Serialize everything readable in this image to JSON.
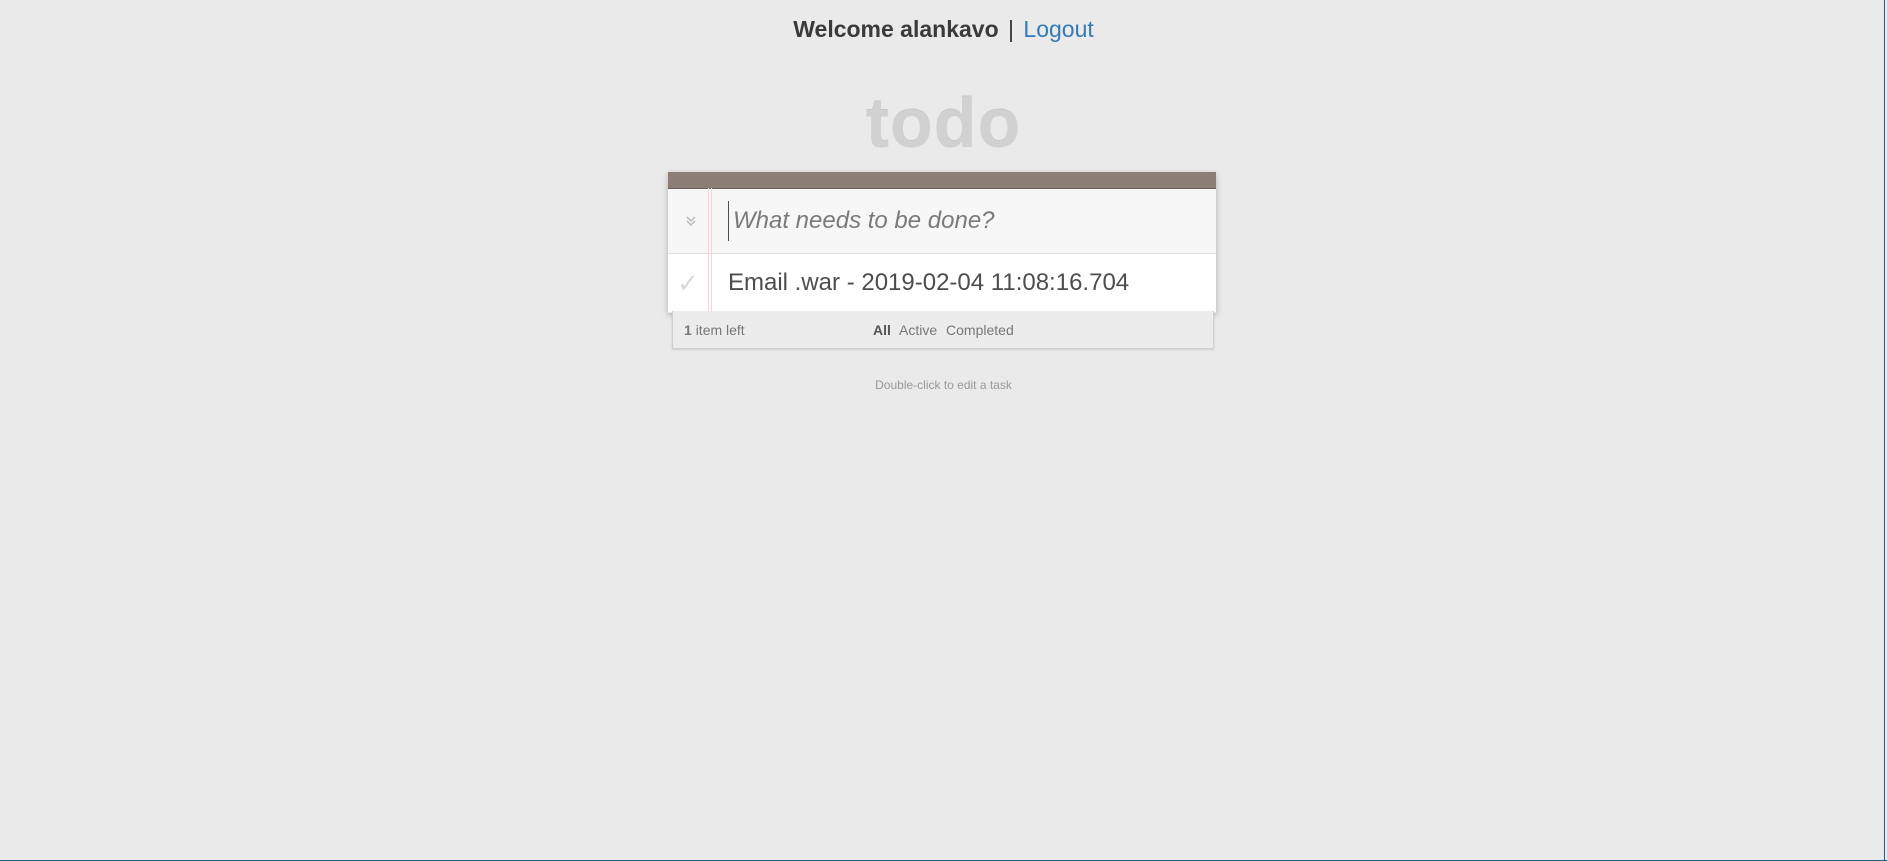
{
  "header": {
    "welcome_text": "Welcome alankavo",
    "separator": "|",
    "logout_label": "Logout"
  },
  "app": {
    "title": "todo",
    "new_todo_placeholder": "What needs to be done?",
    "new_todo_value": "",
    "toggle_all_icon": "double-chevron-down-icon",
    "todos": [
      {
        "label": "Email .war - 2019-02-04 11:08:16.704",
        "completed": false
      }
    ]
  },
  "footer": {
    "count": "1",
    "count_suffix": "item left",
    "filters": [
      {
        "label": "All",
        "selected": true
      },
      {
        "label": "Active",
        "selected": false
      },
      {
        "label": "Completed",
        "selected": false
      }
    ]
  },
  "info": {
    "hint": "Double-click to edit a task"
  },
  "colors": {
    "background": "#eaeaea",
    "topbar": "#8d7d77",
    "link": "#337ab7",
    "title": "#d1d1d1",
    "frame": "#1f5e8a"
  }
}
